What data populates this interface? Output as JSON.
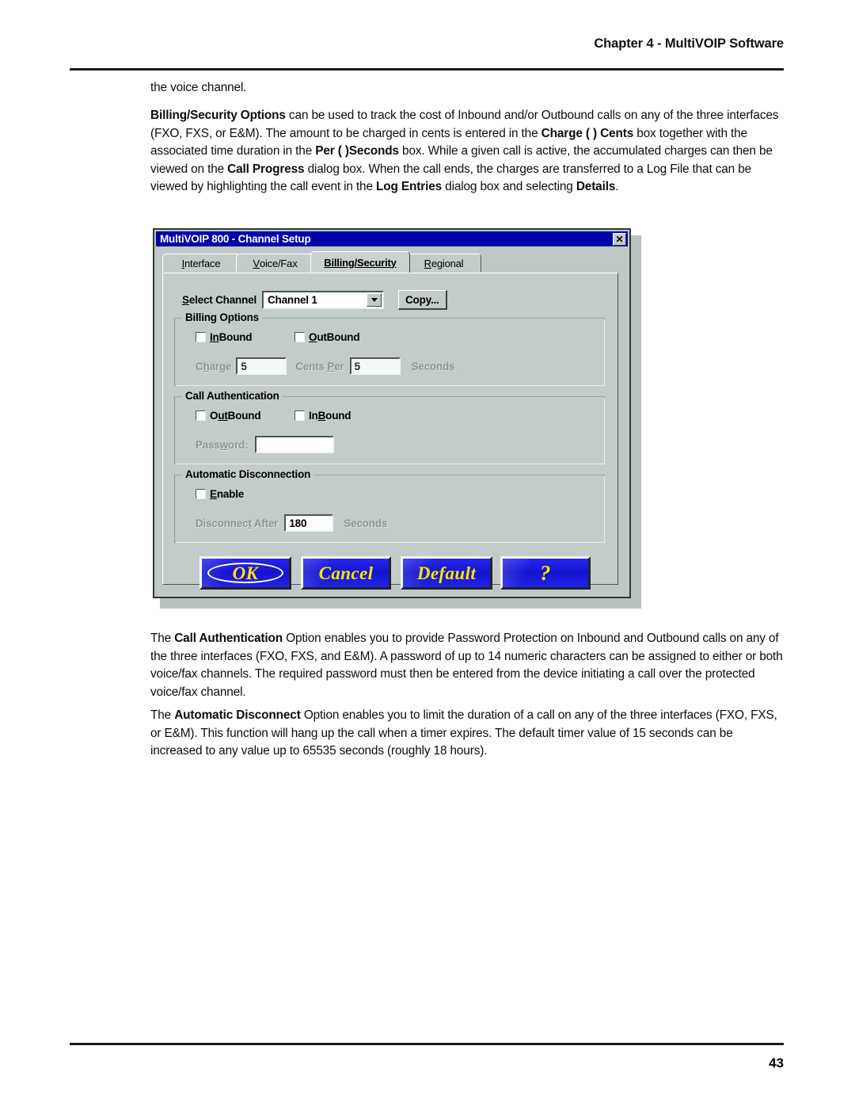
{
  "header": {
    "title": "Chapter 4 - MultiVOIP Software"
  },
  "footer": {
    "page_number": "43"
  },
  "body": {
    "para_voice_channel": "the voice channel.",
    "para_billing_parts": {
      "b1": "Billing/Security Options",
      "t1": " can be used to track the cost of Inbound and/or Outbound calls on any of the three interfaces (FXO, FXS, or E&M).  The amount to be charged in cents is entered in the ",
      "b2": "Charge (    ) Cents",
      "t2": " box together with the associated time duration in the ",
      "b3": "Per (    )Seconds",
      "t3": " box.  While a given call is active, the accumulated charges can then be viewed on the ",
      "b4": "Call Progress",
      "t4": " dialog box.  When the call ends, the charges are transferred to a Log File that can be viewed by highlighting the call event in the ",
      "b5": "Log Entries",
      "t5": " dialog box and selecting ",
      "b6": "Details",
      "t6": "."
    },
    "para_callauth_parts": {
      "t0": "The ",
      "b1": "Call Authentication",
      "t1": " Option enables you to provide Password Protection on Inbound and Outbound calls on any of the three interfaces (FXO, FXS, and E&M).  A password of up to 14 numeric characters can be assigned to either or both voice/fax channels.  The required password must then be entered from the device initiating a call over the protected voice/fax channel."
    },
    "para_autodisc_parts": {
      "t0": "The ",
      "b1": "Automatic Disconnect",
      "t1": " Option enables you to limit the duration of a call on any of the three interfaces (FXO, FXS, or E&M).  This function will hang up the call when a timer expires.  The default timer value of 15 seconds can be increased to any value up to 65535 seconds (roughly 18 hours)."
    }
  },
  "dialog": {
    "title": "MultiVOIP 800 - Channel Setup",
    "close_icon": "close-icon",
    "close_glyph": "✕",
    "tabs": [
      {
        "label_mn": "I",
        "label_rest": "nterface",
        "active": false
      },
      {
        "label_mn": "V",
        "label_rest": "oice/Fax",
        "active": false
      },
      {
        "label_mn": "Billing/Security",
        "label_rest": "",
        "active": true
      },
      {
        "label_mn": "R",
        "label_rest": "egional",
        "active": false
      }
    ],
    "select_channel": {
      "label_mn": "S",
      "label_rest": "elect Channel",
      "value": "Channel 1",
      "arrow_icon": "chevron-down-icon"
    },
    "copy_button": "Copy...",
    "billing_options": {
      "title": "Billing Options",
      "inbound": {
        "mn": "In",
        "rest": "Bound",
        "checked": false
      },
      "outbound": {
        "mn": "O",
        "pre": "",
        "rest": "utBound",
        "checked": false
      },
      "charge_label_a": "C",
      "charge_label_b": "h",
      "charge_label_c": "arge",
      "charge_value": "5",
      "cents_per_a": "Cents ",
      "cents_per_b": "P",
      "cents_per_c": "er",
      "per_value": "5",
      "seconds_label": "Seconds"
    },
    "call_authentication": {
      "title": "Call Authentication",
      "outbound": {
        "pre": "O",
        "mn": "ut",
        "rest": "Bound",
        "checked": false
      },
      "inbound": {
        "pre": "In",
        "mn": "B",
        "rest": "ound",
        "checked": false
      },
      "password_label_a": "Pass",
      "password_label_b": "w",
      "password_label_c": "ord:",
      "password_value": ""
    },
    "automatic_disconnection": {
      "title": "Automatic Disconnection",
      "enable": {
        "mn": "E",
        "rest": "nable",
        "checked": false
      },
      "disconnect_after_a": "Disconnec",
      "disconnect_after_b": "t",
      "disconnect_after_c": " After",
      "disconnect_value": "180",
      "seconds_label": "Seconds"
    },
    "buttons": {
      "ok": "OK",
      "cancel": "Cancel",
      "default_mn": "D",
      "default_rest": "efault",
      "help": "?"
    }
  },
  "colors": {
    "titlebar": "#0000a8",
    "dialog_face": "#c3ccca",
    "button_blue": "#1a1ae6",
    "button_yellow": "#ffe400"
  }
}
